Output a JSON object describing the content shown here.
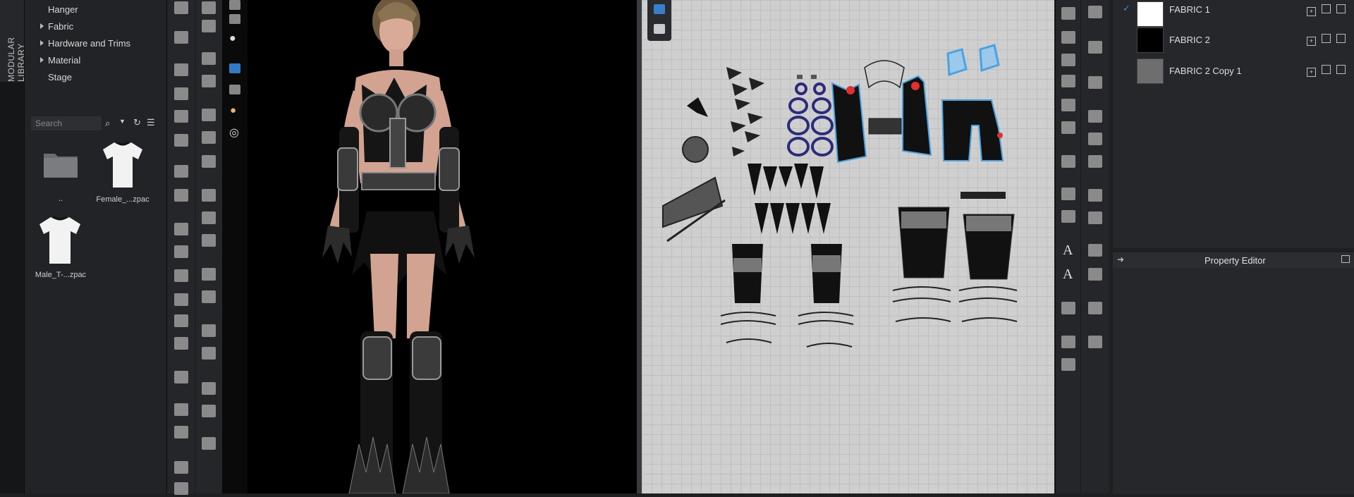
{
  "side_tab": {
    "label": "MODULAR LIBRARY"
  },
  "library": {
    "tree": [
      {
        "label": "Hanger",
        "expandable": false
      },
      {
        "label": "Fabric",
        "expandable": true
      },
      {
        "label": "Hardware and Trims",
        "expandable": true
      },
      {
        "label": "Material",
        "expandable": true
      },
      {
        "label": "Stage",
        "expandable": false
      }
    ],
    "search": {
      "placeholder": "Search"
    },
    "items": [
      {
        "label": ".."
      },
      {
        "label": "Female_...zpac"
      },
      {
        "label": "Male_T-...zpac"
      }
    ]
  },
  "object_browser": {
    "fabrics": [
      {
        "name": "FABRIC 1",
        "swatch": "#ffffff",
        "checked": true
      },
      {
        "name": "FABRIC 2",
        "swatch": "#000000",
        "checked": false
      },
      {
        "name": "FABRIC 2 Copy 1",
        "swatch": "#6e6e6e",
        "checked": false
      }
    ]
  },
  "property_editor": {
    "title": "Property Editor"
  },
  "colors": {
    "accent": "#3a8ee6",
    "highlight": "#4aa3e0",
    "pin": "#e23030"
  }
}
